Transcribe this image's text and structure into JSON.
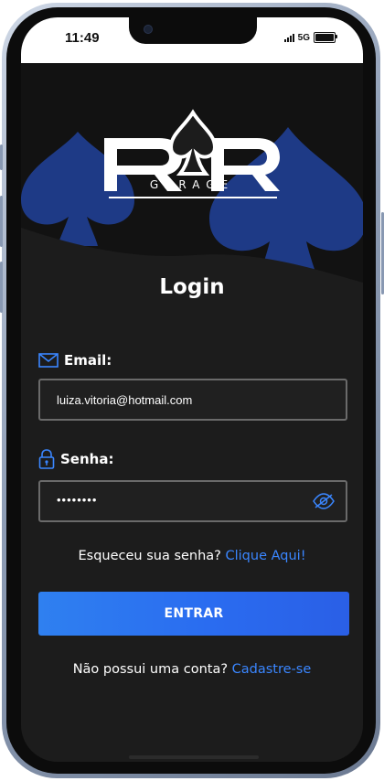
{
  "status": {
    "time": "11:49",
    "network": "5G"
  },
  "logo": {
    "brand": "RR",
    "subtitle": "GARAGE"
  },
  "login": {
    "title": "Login",
    "email_label": "Email:",
    "email_value": "luiza.vitoria@hotmail.com",
    "password_label": "Senha:",
    "password_value": "••••••••",
    "forgot_text": "Esqueceu sua senha?",
    "forgot_link": "Clique Aqui!",
    "submit_label": "ENTRAR",
    "signup_text": "Não possui uma conta?",
    "signup_link": "Cadastre-se"
  },
  "colors": {
    "accent": "#3a86ff",
    "background": "#1c1c1c",
    "spade": "#1f3a86"
  }
}
